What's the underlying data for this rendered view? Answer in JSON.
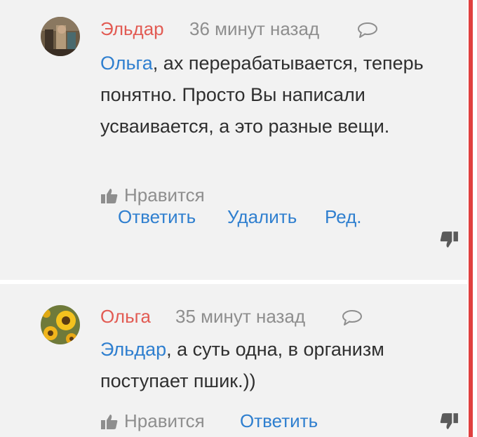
{
  "comments": [
    {
      "author": "Эльдар",
      "time": "36 минут назад",
      "mention": "Ольга",
      "text_rest": ", ах перерабатывается, теперь понятно. Просто Вы написали усваивается, а это разные вещи.",
      "like_label": "Нравится",
      "actions": [
        "Ответить",
        "Удалить",
        "Ред."
      ]
    },
    {
      "author": "Ольга",
      "time": "35 минут назад",
      "mention": "Эльдар",
      "text_rest": ", а суть одна, в организм поступает пшик.))",
      "like_label": "Нравится",
      "actions": [
        "Ответить"
      ]
    }
  ],
  "colors": {
    "accent": "#e0403f",
    "author": "#e25b53",
    "link": "#2f7fcf",
    "muted": "#8e8e8e"
  },
  "icons": {
    "reply": "speech-bubble-icon",
    "like": "thumbs-up-icon",
    "dislike": "thumbs-down-icon"
  }
}
